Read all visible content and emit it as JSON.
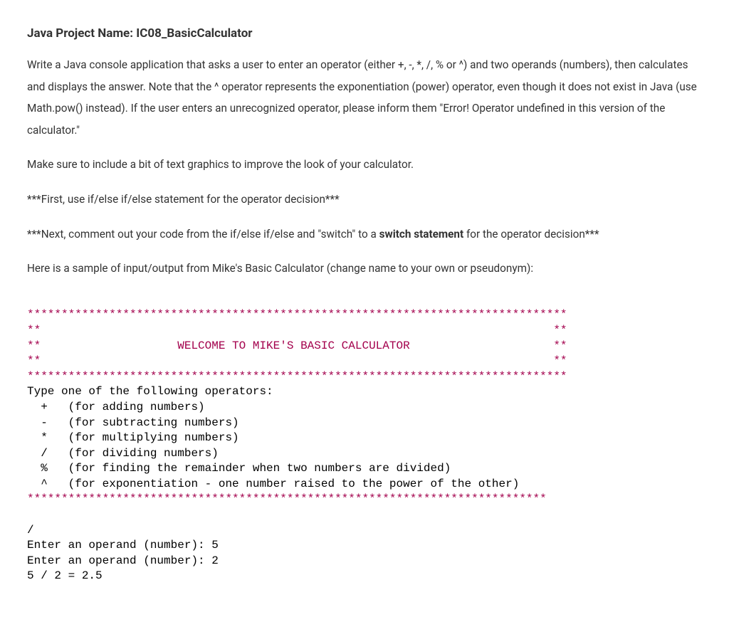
{
  "title_prefix": "Java Project Name:  ",
  "title_name": "IC08_BasicCalculator",
  "para1": "Write a Java console application that asks a user to enter an operator (either +, -, *, /, % or ^) and two operands (numbers), then calculates and displays the answer.  Note that the ^ operator represents the exponentiation (power) operator, even though it does not exist in Java (use Math.pow() instead).  If the user enters an unrecognized operator, please inform them \"Error!  Operator undefined in this version of the calculator.\"",
  "para2": "Make sure to include a bit of text graphics to improve the look of your calculator.",
  "para3": "***First, use if/else if/else statement for the operator decision***",
  "para4_pre": "***Next, comment out your code from the if/else if/else and \"switch\" to a ",
  "para4_bold": "switch statement",
  "para4_post": " for the operator decision***",
  "para5": "Here is a sample of input/output from Mike's Basic Calculator (change name to your own or pseudonym):",
  "console": {
    "border_top": "*******************************************************************************",
    "row1": "**                                                                           **",
    "row2": "**                    WELCOME TO MIKE'S BASIC CALCULATOR                     **",
    "row3": "**                                                                           **",
    "border_bot": "*******************************************************************************",
    "prompt0": "Type one of the following operators:",
    "op1": "  +   (for adding numbers)",
    "op2": "  -   (for subtracting numbers)",
    "op3": "  *   (for multiplying numbers)",
    "op4": "  /   (for dividing numbers)",
    "op5": "  %   (for finding the remainder when two numbers are divided)",
    "op6": "  ^   (for exponentiation - one number raised to the power of the other)",
    "border_mid": "****************************************************************************",
    "input_op": "/",
    "prompt_a_text": "Enter an operand (number): ",
    "input_a": "5",
    "prompt_b_text": "Enter an operand (number): ",
    "input_b": "2",
    "result": "5 / 2 = 2.5"
  }
}
